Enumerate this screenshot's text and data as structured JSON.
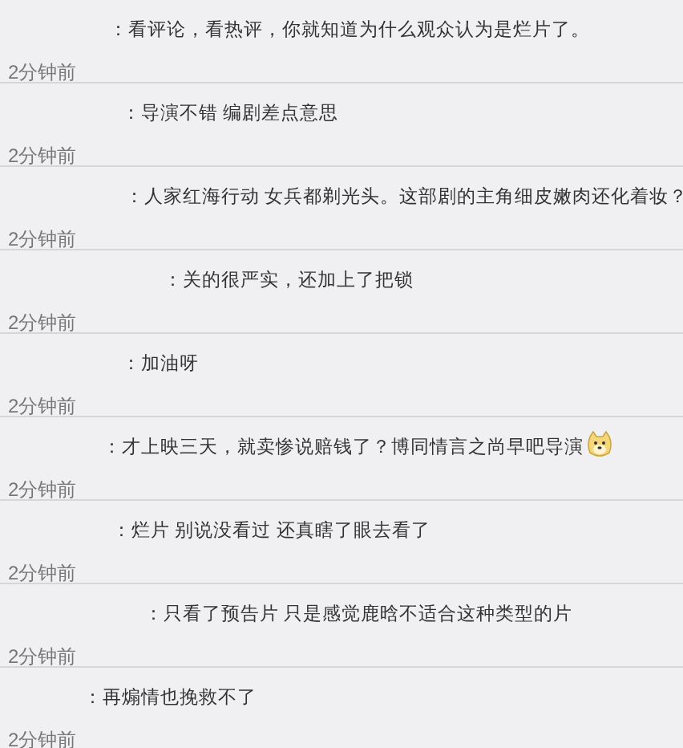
{
  "comments": [
    {
      "text": "：看评论，看热评，你就知道为什么观众认为是烂片了。",
      "time": "2分钟前"
    },
    {
      "text": "：导演不错 编剧差点意思",
      "time": "2分钟前"
    },
    {
      "text": "：人家红海行动 女兵都剃光头。这部剧的主角细皮嫩肉还化着妆？",
      "time": "2分钟前"
    },
    {
      "text": "：关的很严实，还加上了把锁",
      "time": "2分钟前"
    },
    {
      "text": "：加油呀",
      "time": "2分钟前"
    },
    {
      "text": "：才上映三天，就卖惨说赔钱了？博同情言之尚早吧导演",
      "time": "2分钟前",
      "has_emoji": true
    },
    {
      "text": "：烂片 别说没看过 还真瞎了眼去看了",
      "time": "2分钟前"
    },
    {
      "text": "：只看了预告片 只是感觉鹿晗不适合这种类型的片",
      "time": "2分钟前"
    },
    {
      "text": "：再煽情也挽救不了",
      "time": "2分钟前"
    }
  ]
}
